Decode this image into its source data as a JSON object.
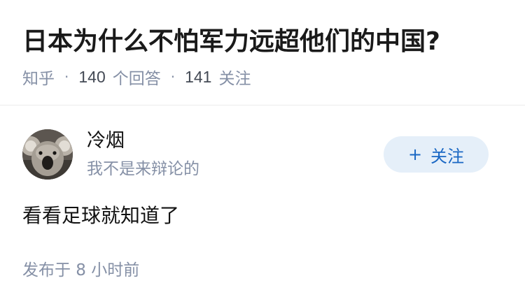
{
  "question": {
    "title": "日本为什么不怕军力远超他们的中国?",
    "source": "知乎",
    "separator": "·",
    "answer_count": "140",
    "answer_label": "个回答",
    "follower_count": "141",
    "follower_label": "关注"
  },
  "answer": {
    "author": {
      "name": "冷烟",
      "bio": "我不是来辩论的",
      "avatar_icon": "koala-avatar"
    },
    "follow_button": {
      "icon": "+",
      "label": "关注"
    },
    "content": "看看足球就知道了",
    "publish_time": "发布于 8 小时前"
  },
  "colors": {
    "title": "#1a1a1a",
    "meta_gray": "#8590a6",
    "follow_bg": "#e5eff9",
    "follow_text": "#1967c4",
    "divider": "#ececec"
  }
}
